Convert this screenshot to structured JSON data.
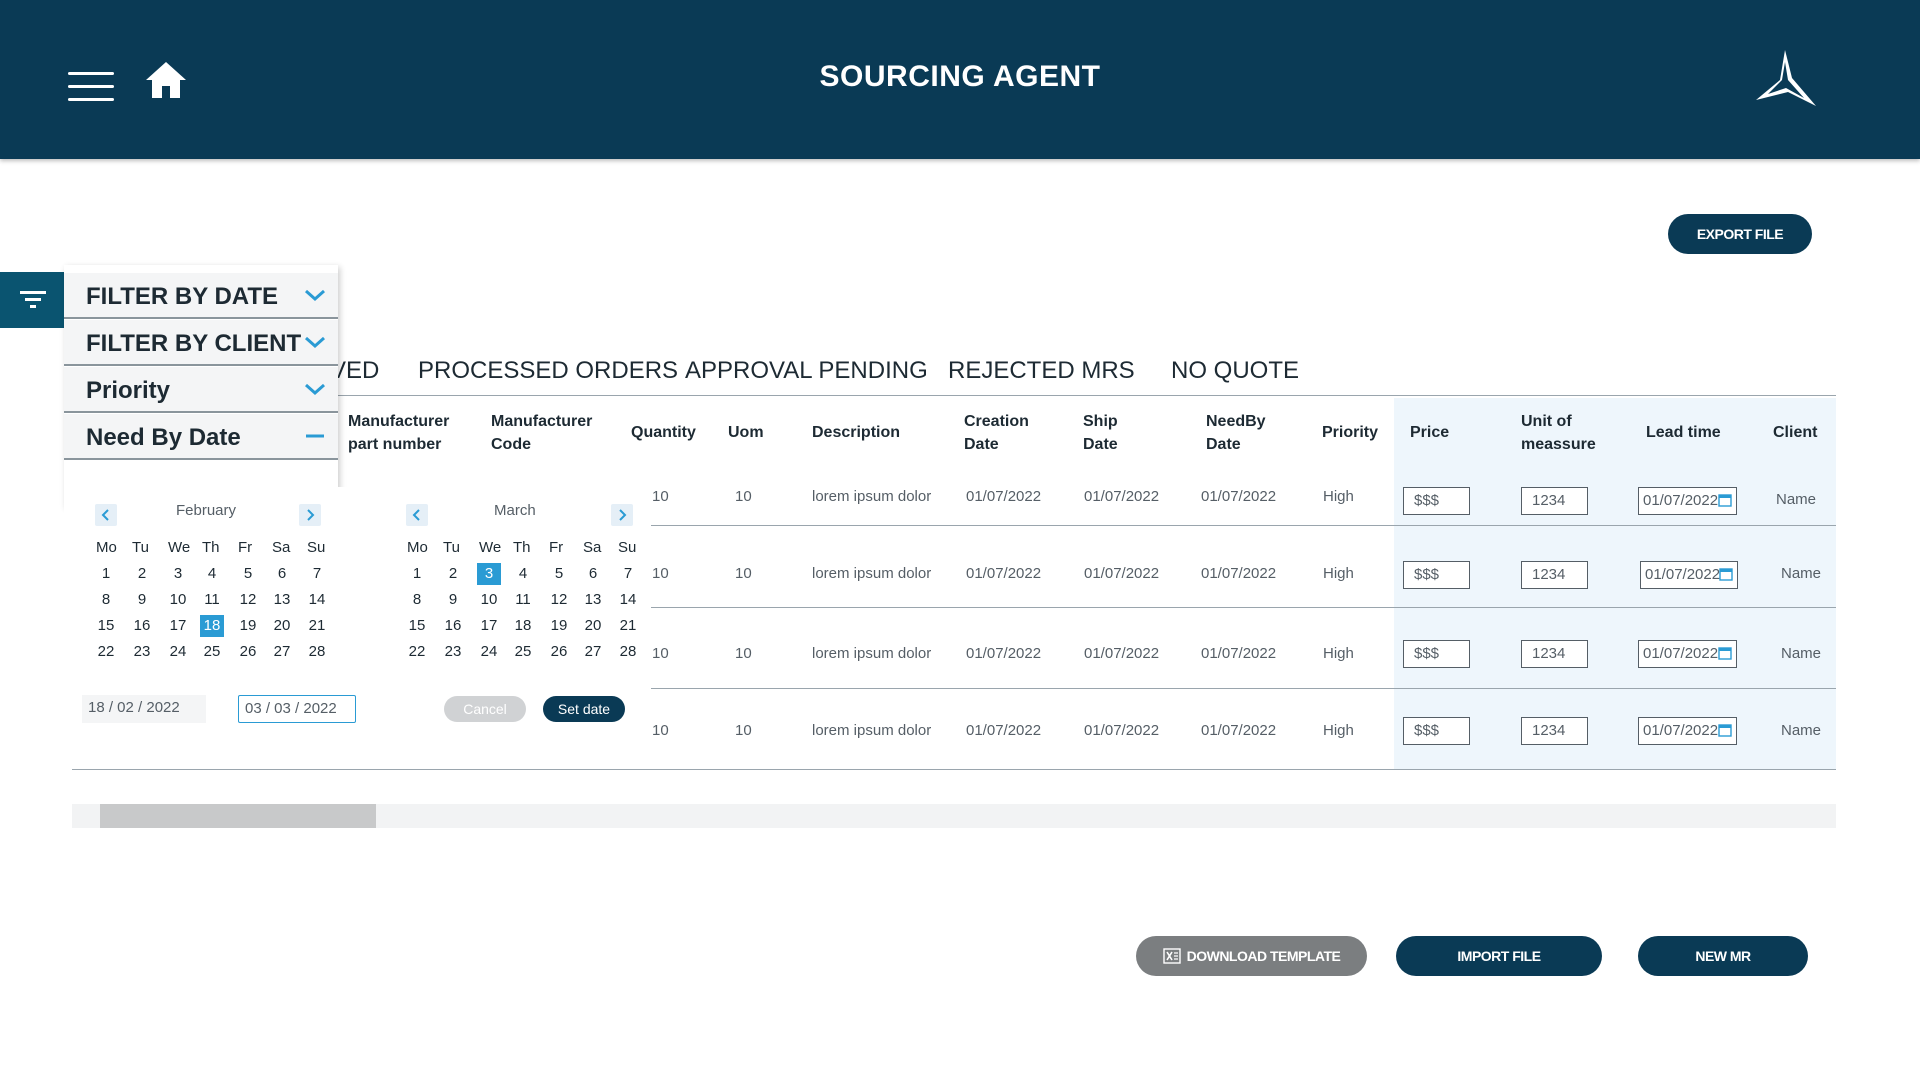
{
  "header": {
    "title": "SOURCING AGENT"
  },
  "actions": {
    "export": "EXPORT FILE",
    "download_template": "DOWNLOAD TEMPLATE",
    "import": "IMPORT FILE",
    "new_mr": "NEW MR"
  },
  "tabs": [
    "VED",
    "PROCESSED ORDERS",
    "APPROVAL PENDING",
    "REJECTED MRS",
    "NO QUOTE"
  ],
  "columns": {
    "manufacturer_part": [
      "Manufacturer",
      "part number"
    ],
    "manufacturer_code": [
      "Manufacturer",
      "Code"
    ],
    "quantity": "Quantity",
    "uom": "Uom",
    "description": "Description",
    "creation_date": [
      "Creation",
      "Date"
    ],
    "ship_date": [
      "Ship",
      "Date"
    ],
    "needby_date": [
      "NeedBy",
      "Date"
    ],
    "priority": "Priority",
    "price": "Price",
    "unit_of_measure": [
      "Unit of",
      "meassure"
    ],
    "lead_time": "Lead time",
    "client": "Client"
  },
  "rows": [
    {
      "quantity": "10",
      "uom": "10",
      "description": "lorem ipsum dolor",
      "creation_date": "01/07/2022",
      "ship_date": "01/07/2022",
      "needby_date": "01/07/2022",
      "priority": "High",
      "price": "$$$",
      "unit": "1234",
      "lead_time": "01/07/2022",
      "client": "Name"
    },
    {
      "quantity": "10",
      "uom": "10",
      "description": "lorem ipsum dolor",
      "creation_date": "01/07/2022",
      "ship_date": "01/07/2022",
      "needby_date": "01/07/2022",
      "priority": "High",
      "price": "$$$",
      "unit": "1234",
      "lead_time": "01/07/2022",
      "client": "Name"
    },
    {
      "quantity": "10",
      "uom": "10",
      "description": "lorem ipsum dolor",
      "creation_date": "01/07/2022",
      "ship_date": "01/07/2022",
      "needby_date": "01/07/2022",
      "priority": "High",
      "price": "$$$",
      "unit": "1234",
      "lead_time": "01/07/2022",
      "client": "Name"
    },
    {
      "quantity": "10",
      "uom": "10",
      "description": "lorem ipsum dolor",
      "creation_date": "01/07/2022",
      "ship_date": "01/07/2022",
      "needby_date": "01/07/2022",
      "priority": "High",
      "price": "$$$",
      "unit": "1234",
      "lead_time": "01/07/2022",
      "client": "Name"
    }
  ],
  "filters": {
    "items": [
      "FILTER BY DATE",
      "FILTER BY CLIENT",
      "Priority",
      "Need By Date"
    ]
  },
  "calendar": {
    "days_of_week": [
      "Mo",
      "Tu",
      "We",
      "Th",
      "Fr",
      "Sa",
      "Su"
    ],
    "left": {
      "month": "February",
      "weeks": [
        [
          "1",
          "2",
          "3",
          "4",
          "5",
          "6",
          "7"
        ],
        [
          "8",
          "9",
          "10",
          "11",
          "12",
          "13",
          "14"
        ],
        [
          "15",
          "16",
          "17",
          "18",
          "19",
          "20",
          "21"
        ],
        [
          "22",
          "23",
          "24",
          "25",
          "26",
          "27",
          "28"
        ]
      ],
      "selected": "18"
    },
    "right": {
      "month": "March",
      "weeks": [
        [
          "1",
          "2",
          "3",
          "4",
          "5",
          "6",
          "7"
        ],
        [
          "8",
          "9",
          "10",
          "11",
          "12",
          "13",
          "14"
        ],
        [
          "15",
          "16",
          "17",
          "18",
          "19",
          "20",
          "21"
        ],
        [
          "22",
          "23",
          "24",
          "25",
          "26",
          "27",
          "28"
        ]
      ],
      "selected": "3"
    },
    "start_date": "18 / 02 / 2022",
    "end_date": "03 / 03 / 2022",
    "cancel": "Cancel",
    "set_date": "Set date"
  },
  "colors": {
    "primary": "#0a3a55",
    "accent": "#2a9bd4",
    "gray_button": "#7b7e80"
  }
}
